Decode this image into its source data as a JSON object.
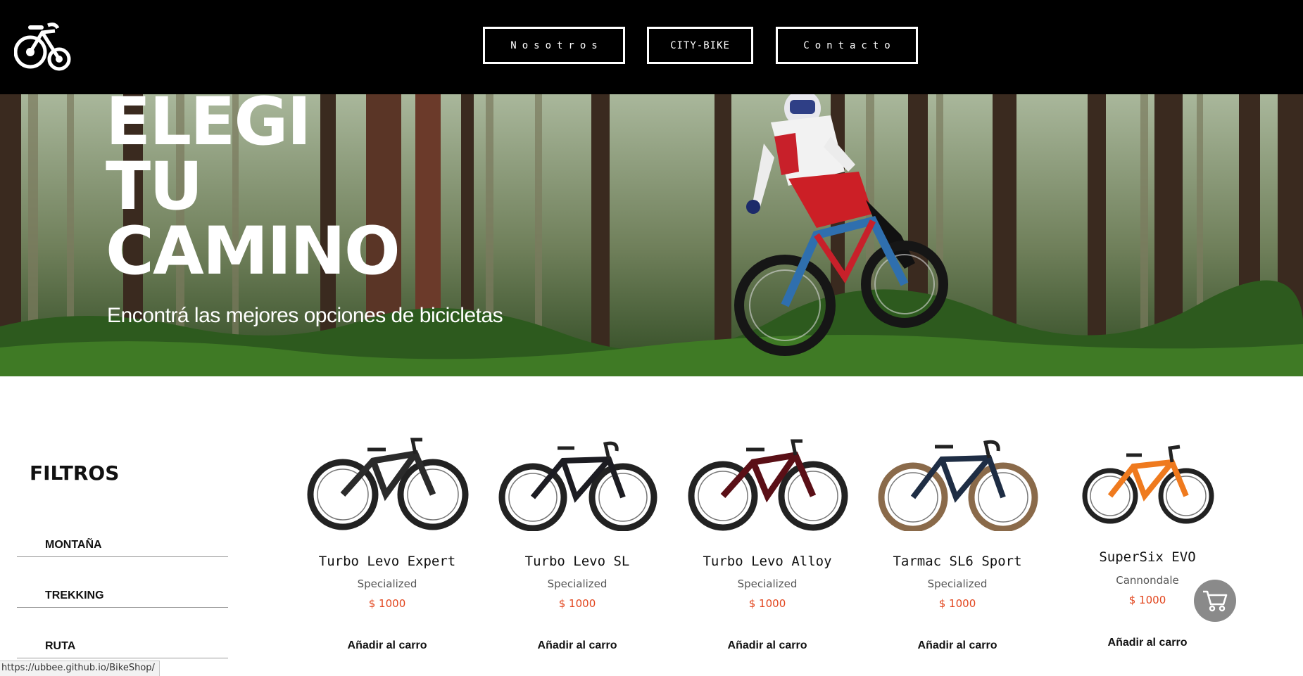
{
  "header": {
    "logo_icon": "tricycle-logo-icon",
    "nav": [
      {
        "label": "Nosotros"
      },
      {
        "label": "CITY-BIKE"
      },
      {
        "label": "Contacto"
      }
    ]
  },
  "hero": {
    "title_lines": [
      "ELEGI",
      "TU",
      "CAMINO"
    ],
    "subtitle": "Encontrá las mejores opciones de bicicletas"
  },
  "filters": {
    "title": "FILTROS",
    "items": [
      "MONTAÑA",
      "TREKKING",
      "RUTA"
    ]
  },
  "products": [
    {
      "name": "Turbo Levo Expert",
      "brand": "Specialized",
      "price": "$ 1000",
      "add_label": "Añadir al carro",
      "frame_color": "#2b2b2b"
    },
    {
      "name": "Turbo Levo SL",
      "brand": "Specialized",
      "price": "$ 1000",
      "add_label": "Añadir al carro",
      "frame_color": "#1c1c22"
    },
    {
      "name": "Turbo Levo Alloy",
      "brand": "Specialized",
      "price": "$ 1000",
      "add_label": "Añadir al carro",
      "frame_color": "#5a0f16"
    },
    {
      "name": "Tarmac SL6 Sport",
      "brand": "Specialized",
      "price": "$ 1000",
      "add_label": "Añadir al carro",
      "frame_color": "#1e2d44"
    },
    {
      "name": "SuperSix EVO",
      "brand": "Cannondale",
      "price": "$ 1000",
      "add_label": "Añadir al carro",
      "frame_color": "#ef7a1e"
    }
  ],
  "cart": {
    "icon": "shopping-cart-icon"
  },
  "status_bar": {
    "url": "https://ubbee.github.io/BikeShop/"
  }
}
